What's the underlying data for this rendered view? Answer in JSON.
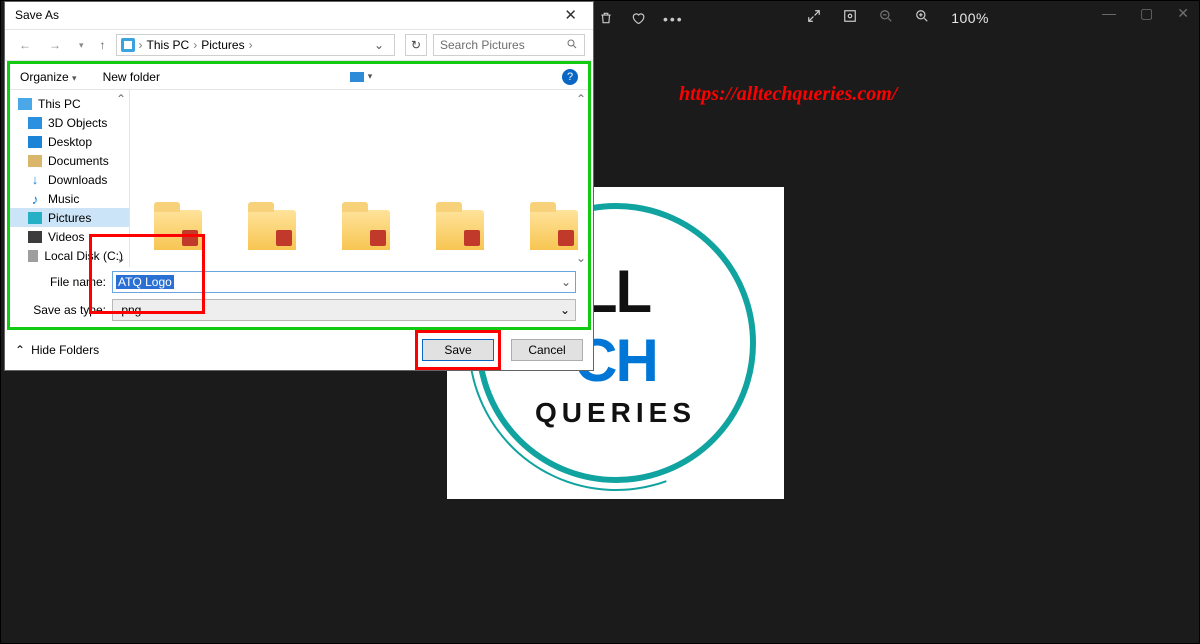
{
  "app_bar": {
    "zoom_label": "100%",
    "trash_icon": "trash",
    "heart_icon": "favorite",
    "more_icon": "more"
  },
  "url_overlay": "https://alltechqueries.com/",
  "logo": {
    "top": "CH",
    "left": "LL",
    "bottom": "QUERIES"
  },
  "dialog": {
    "title": "Save As",
    "breadcrumb": {
      "root": "This PC",
      "folder": "Pictures"
    },
    "search_placeholder": "Search Pictures",
    "toolbar": {
      "organize": "Organize",
      "new_folder": "New folder"
    },
    "sidebar": [
      {
        "label": "This PC",
        "icon": "ico-pc",
        "root": true,
        "selected": false
      },
      {
        "label": "3D Objects",
        "icon": "ico-3d",
        "root": false,
        "selected": false
      },
      {
        "label": "Desktop",
        "icon": "ico-desktop",
        "root": false,
        "selected": false
      },
      {
        "label": "Documents",
        "icon": "ico-docs",
        "root": false,
        "selected": false
      },
      {
        "label": "Downloads",
        "icon": "ico-dl",
        "root": false,
        "selected": false,
        "glyph": "↓"
      },
      {
        "label": "Music",
        "icon": "ico-music",
        "root": false,
        "selected": false,
        "glyph": "♪"
      },
      {
        "label": "Pictures",
        "icon": "ico-pics",
        "root": false,
        "selected": true
      },
      {
        "label": "Videos",
        "icon": "ico-videos",
        "root": false,
        "selected": false
      },
      {
        "label": "Local Disk (C:)",
        "icon": "ico-disk",
        "root": false,
        "selected": false
      }
    ],
    "folders": [
      "",
      "",
      "",
      "",
      ""
    ],
    "filename_label": "File name:",
    "filename_value": "ATQ Logo",
    "type_label": "Save as type:",
    "type_value": ".png",
    "hide_folders": "Hide Folders",
    "save": "Save",
    "cancel": "Cancel"
  }
}
